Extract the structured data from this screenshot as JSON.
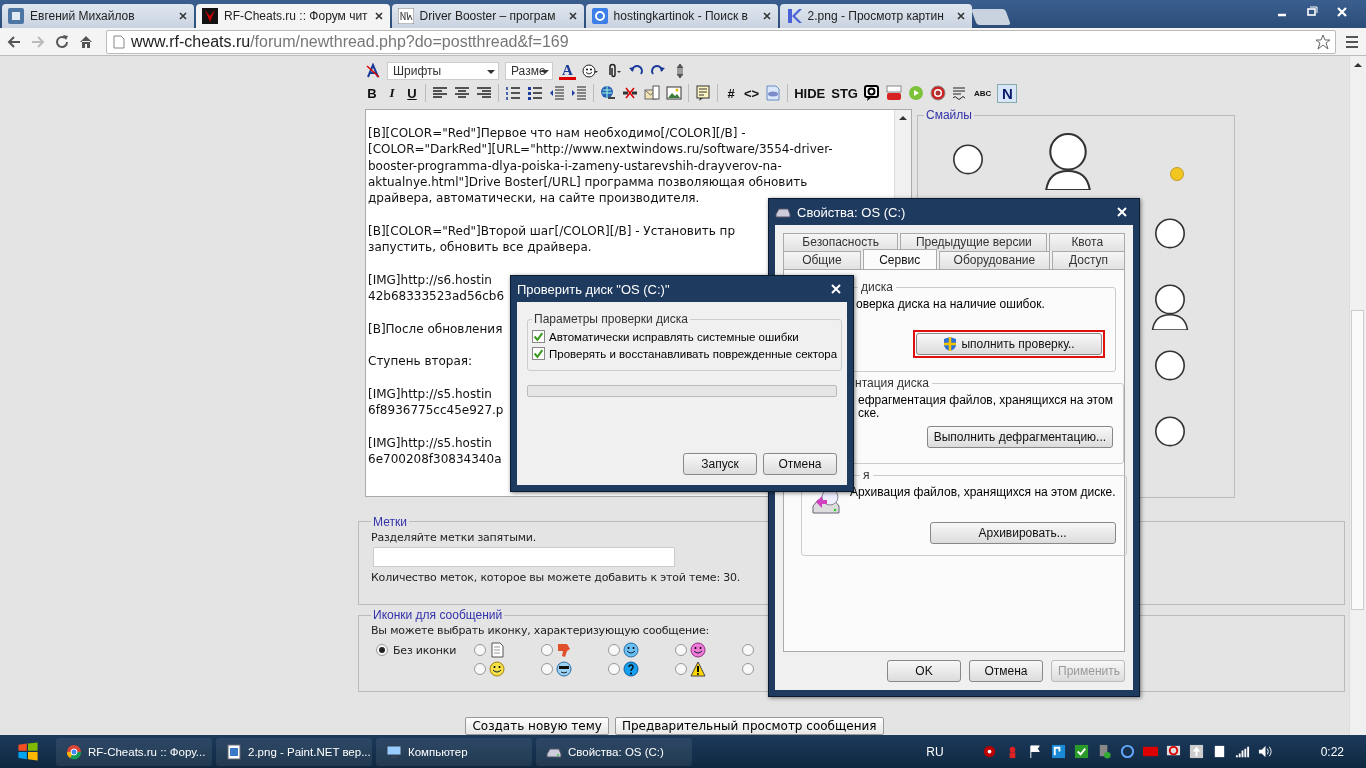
{
  "browser": {
    "tabs": [
      {
        "title": "Евгений Михайлов",
        "kind": "vk",
        "selected": false
      },
      {
        "title": "RF-Cheats.ru :: Форум чит",
        "kind": "rf",
        "selected": true
      },
      {
        "title": "Driver Booster – програм",
        "kind": "nw",
        "selected": false
      },
      {
        "title": "hostingkartinok - Поиск в",
        "kind": "g",
        "selected": false
      },
      {
        "title": "2.png - Просмотр картин",
        "kind": "k",
        "selected": false
      }
    ],
    "address": {
      "host": "www.rf-cheats.ru",
      "path": "/forum/newthread.php?do=postthread&f=169"
    }
  },
  "editor": {
    "font_select": "Шрифты",
    "size_select": "Разме",
    "toolbar_top": [
      {
        "kind": "clear"
      },
      {
        "kind": "font"
      },
      {
        "kind": "size"
      },
      {
        "kind": "color",
        "label": "A"
      },
      {
        "kind": "smiley"
      },
      {
        "kind": "attach"
      },
      {
        "kind": "undo"
      },
      {
        "kind": "redo"
      },
      {
        "kind": "resize"
      }
    ],
    "toolbar_bottom": [
      {
        "kind": "bold",
        "label": "B"
      },
      {
        "kind": "italic",
        "label": "I"
      },
      {
        "kind": "underline",
        "label": "U"
      },
      {
        "kind": "sep"
      },
      {
        "kind": "align-left"
      },
      {
        "kind": "align-center"
      },
      {
        "kind": "align-right"
      },
      {
        "kind": "sep"
      },
      {
        "kind": "ol"
      },
      {
        "kind": "ul"
      },
      {
        "kind": "outdent"
      },
      {
        "kind": "indent"
      },
      {
        "kind": "sep"
      },
      {
        "kind": "link"
      },
      {
        "kind": "unlink"
      },
      {
        "kind": "email"
      },
      {
        "kind": "image"
      },
      {
        "kind": "sep"
      },
      {
        "kind": "quote"
      },
      {
        "kind": "sep"
      },
      {
        "kind": "word",
        "label": "#"
      },
      {
        "kind": "word",
        "label": "<>"
      },
      {
        "kind": "php"
      },
      {
        "kind": "sep"
      },
      {
        "kind": "word",
        "label": "HIDE"
      },
      {
        "kind": "word",
        "label": "STG"
      },
      {
        "kind": "speech"
      },
      {
        "kind": "video"
      },
      {
        "kind": "play"
      },
      {
        "kind": "stop"
      },
      {
        "kind": "wave"
      },
      {
        "kind": "small",
        "label": "ABC"
      },
      {
        "kind": "boxed",
        "label": "N"
      }
    ],
    "paragraphs": [
      [
        "[B][COLOR=\"Red\"]Первое что нам необходимо[/COLOR][/B] -",
        "[COLOR=\"DarkRed\"][URL=\"http://www.nextwindows.ru/software/3554-driver-",
        "booster-programma-dlya-poiska-i-zameny-ustarevshih-drayverov-na-",
        "aktualnye.html\"]Drive Boster[/URL] программа позволяющая обновить",
        "драйвера, автоматически, на сайте производителя."
      ],
      [
        "[B][COLOR=\"Red\"]Второй шаг[/COLOR][/B] - Установить пр",
        "запустить, обновить все драйвера."
      ],
      [
        "[IMG]http://s6.hostin",
        "42b68333523ad56cb6"
      ],
      [
        "[B]После обновления"
      ],
      [
        "Ступень вторая:"
      ],
      [
        "[IMG]http://s5.hostin",
        "6f8936775cc45e927.p"
      ],
      [
        "[IMG]http://s5.hostin",
        "6e700208f30834340a"
      ]
    ]
  },
  "smilies": {
    "title": "Смайлы",
    "top_row": [
      {
        "kind": "face"
      },
      {
        "kind": "figure"
      },
      {
        "kind": "small"
      }
    ],
    "right_column": [
      {
        "kind": "face"
      },
      {
        "kind": "figure"
      },
      {
        "kind": "face"
      },
      {
        "kind": "face"
      }
    ]
  },
  "tags": {
    "title": "Метки",
    "hint": "Разделяйте метки запятыми.",
    "note": "Количество меток, которое вы можете добавить к этой теме: 30."
  },
  "message_icons": {
    "title": "Иконки для сообщений",
    "prompt": "Вы можете выбрать иконку, характеризующую сообщение:",
    "none": {
      "label": "Без иконки",
      "selected": true
    },
    "options": [
      {
        "kind": "document",
        "selected": false
      },
      {
        "kind": "thumb",
        "selected": false
      },
      {
        "kind": "blue",
        "selected": false
      },
      {
        "kind": "pink",
        "selected": false
      },
      {
        "kind": "hidden",
        "selected": false
      },
      {
        "kind": "yellow",
        "selected": false
      },
      {
        "kind": "cool",
        "selected": false
      },
      {
        "kind": "question",
        "selected": false
      },
      {
        "kind": "warning",
        "selected": false
      },
      {
        "kind": "hidden",
        "selected": false
      }
    ]
  },
  "form_buttons": [
    "Создать новую тему",
    "Предварительный просмотр сообщения"
  ],
  "properties_window": {
    "title": "Свойства: OS (C:)",
    "tab_rows": [
      [
        {
          "label": "Безопасность",
          "selected": false
        },
        {
          "label": "Предыдущие версии",
          "selected": false
        },
        {
          "label": "Квота",
          "selected": false
        }
      ],
      [
        {
          "label": "Общие",
          "selected": false
        },
        {
          "label": "Сервис",
          "selected": true
        },
        {
          "label": "Оборудование",
          "selected": false
        },
        {
          "label": "Доступ",
          "selected": false
        }
      ]
    ],
    "groups": [
      {
        "kind": "check",
        "title": "диска",
        "lines": [
          "оверка диска на наличие ошибок."
        ],
        "button": "ыполнить проверку..",
        "highlighted": true
      },
      {
        "kind": "defrag",
        "title": "нтация диска",
        "lines": [
          "ефрагментация файлов, хранящихся на этом",
          "ске."
        ],
        "button": "Выполнить дефрагментацию...",
        "highlighted": false
      },
      {
        "kind": "backup",
        "title": "я",
        "lines": [
          "Архивация файлов, хранящихся на этом диске."
        ],
        "button": "Архивировать...",
        "highlighted": false
      }
    ],
    "buttons": [
      {
        "label": "OK",
        "disabled": false
      },
      {
        "label": "Отмена",
        "disabled": false
      },
      {
        "label": "Применить",
        "disabled": true
      }
    ]
  },
  "check_disk": {
    "title": "Проверить диск \"OS (C:)\"",
    "group": "Параметры проверки диска",
    "options": [
      {
        "label": "Автоматически исправлять системные ошибки",
        "checked": true
      },
      {
        "label": "Проверять и восстанавливать поврежденные сектора",
        "checked": true
      }
    ],
    "progress": {
      "level": 0
    },
    "buttons": [
      "Запуск",
      "Отмена"
    ]
  },
  "taskbar": {
    "tasks": [
      {
        "title": "RF-Cheats.ru :: Фору...",
        "kind": "chrome"
      },
      {
        "title": "2.png - Paint.NET вер...",
        "kind": "paint"
      },
      {
        "title": "Компьютер",
        "kind": "computer"
      },
      {
        "title": "Свойства: OS (C:)",
        "kind": "drive"
      }
    ],
    "language": "RU",
    "time": "0:22"
  }
}
